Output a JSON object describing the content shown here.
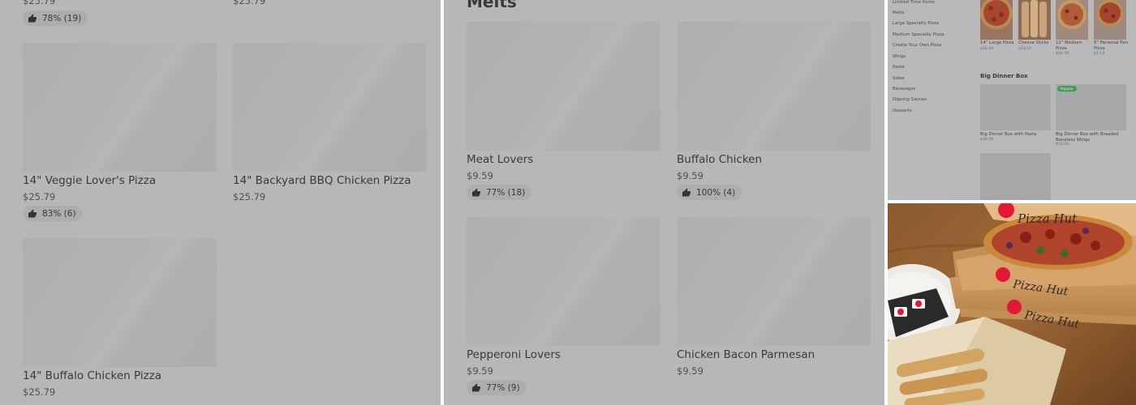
{
  "panel1": {
    "top_price_left": "$25.79",
    "top_price_right": "$25.79",
    "top_rating": "78% (19)",
    "items": [
      {
        "name": "14\" Veggie Lover's Pizza",
        "price": "$25.79",
        "rating": "83% (6)"
      },
      {
        "name": "14\" Backyard BBQ Chicken Pizza",
        "price": "$25.79"
      },
      {
        "name": "14\" Buffalo Chicken Pizza",
        "price": "$25.79"
      }
    ]
  },
  "panel2": {
    "section_title": "Melts",
    "items": [
      {
        "name": "Meat Lovers",
        "price": "$9.59",
        "rating": "77% (18)"
      },
      {
        "name": "Buffalo Chicken",
        "price": "$9.59",
        "rating": "100% (4)"
      },
      {
        "name": "Pepperoni Lovers",
        "price": "$9.59",
        "rating": "77% (9)"
      },
      {
        "name": "Chicken Bacon Parmesan",
        "price": "$9.59"
      }
    ]
  },
  "panel3": {
    "sidebar": [
      "Limited Time Items",
      "Melts",
      "Large Specialty Pizza",
      "Medium Specialty Pizza",
      "Create Your Own Pizza",
      "Wings",
      "Pasta",
      "Sides",
      "Beverages",
      "Dipping Sauces",
      "Desserts"
    ],
    "top_items": [
      {
        "name": "14\" Large Pizza",
        "price": "$18.99"
      },
      {
        "name": "Cheese Sticks",
        "price": "$10.19"
      },
      {
        "name": "12\" Medium Pizza",
        "price": "$16.79"
      },
      {
        "name": "6\" Personal Pan Pizza",
        "price": "$7.19"
      }
    ],
    "section_title": "Big Dinner Box",
    "box_items": [
      {
        "name": "Big Dinner Box with Pasta",
        "price": "$34.59"
      },
      {
        "name": "Big Dinner Box with Breaded Boneless Wings",
        "price": "$33.59",
        "badge": "Popular"
      }
    ]
  },
  "photo": {
    "brand_text": "Pizza Hut"
  },
  "colors": {
    "overlay_gray": "#b7b7b7",
    "badge_green": "#3f9a56",
    "brand_red": "#e31837"
  }
}
